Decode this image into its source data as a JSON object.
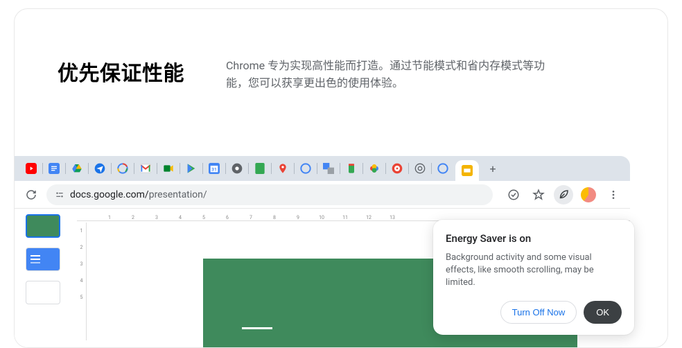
{
  "hero": {
    "title": "优先保证性能",
    "description": "Chrome 专为实现高性能而打造。通过节能模式和省内存模式等功能，您可以获享更出色的使用体验。"
  },
  "omnibox": {
    "domain": "docs.google.com/",
    "path": "presentation/"
  },
  "tabs": {
    "favicons": [
      "youtube",
      "docs",
      "drive",
      "travel",
      "google",
      "gmail",
      "meet",
      "play",
      "calendar",
      "chrome-dark",
      "keep",
      "maps",
      "google",
      "translate",
      "phone",
      "photos",
      "target",
      "chrome-outline",
      "google"
    ],
    "active_favicon": "slides",
    "new_tab_glyph": "+"
  },
  "ruler": {
    "h": [
      "1",
      "2",
      "3",
      "4",
      "5",
      "6",
      "7",
      "8",
      "9",
      "10",
      "11",
      "12",
      "13"
    ],
    "v": [
      "1",
      "2",
      "3",
      "4",
      "5"
    ]
  },
  "popover": {
    "title": "Energy Saver is on",
    "body": "Background activity and some visual effects, like smooth scrolling, may be limited.",
    "secondary": "Turn Off Now",
    "primary": "OK"
  },
  "colors": {
    "slide_green": "#3f8a5c",
    "tabstrip": "#dde3ea"
  }
}
